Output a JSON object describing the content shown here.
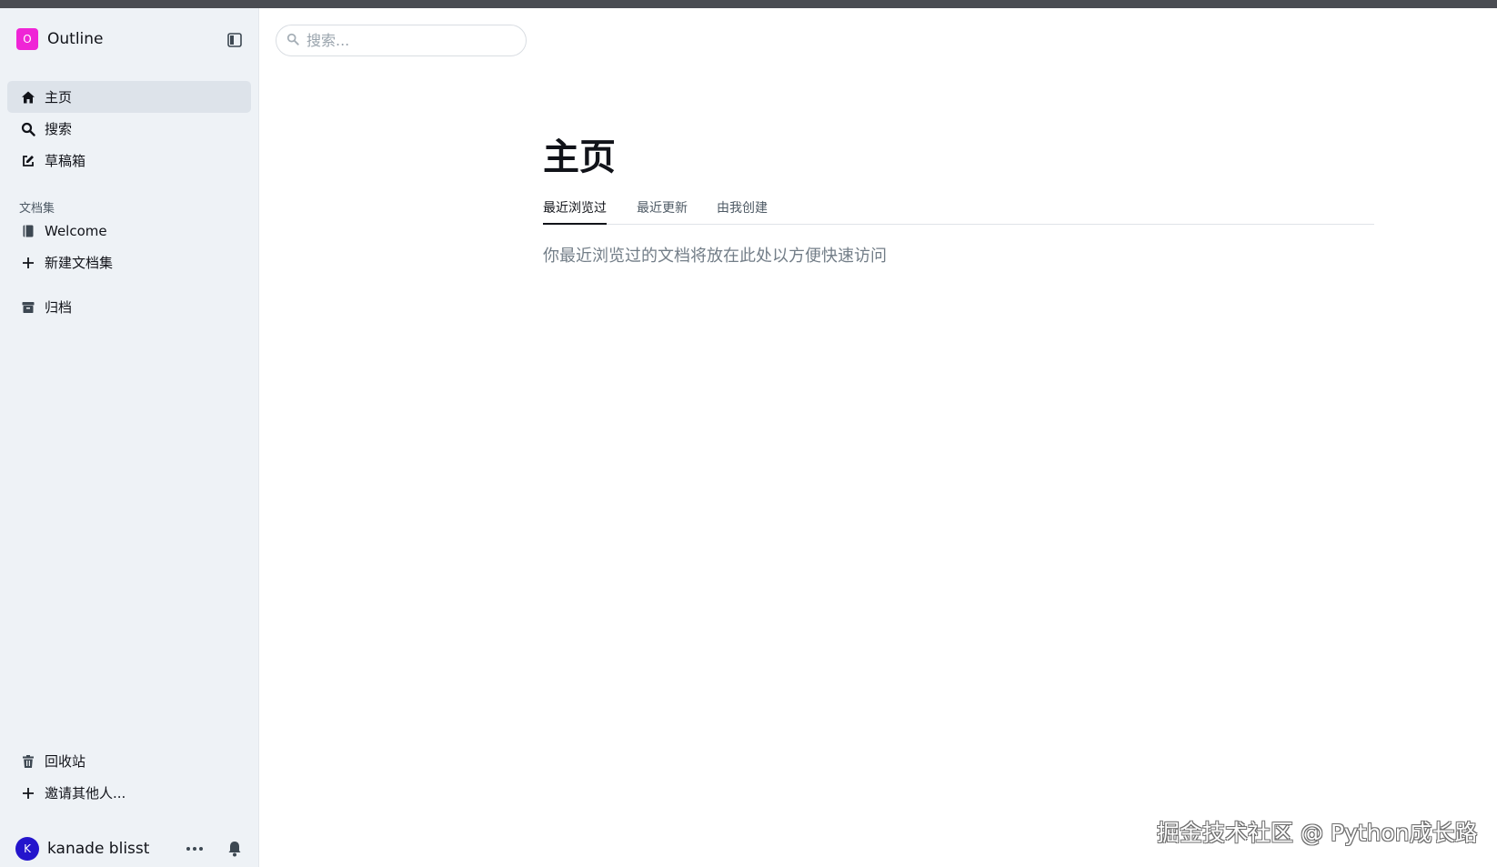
{
  "brand": {
    "logo_letter": "O",
    "name": "Outline",
    "logo_color": "#ef25d6"
  },
  "nav": {
    "home": "主页",
    "search": "搜索",
    "drafts": "草稿箱"
  },
  "collections": {
    "section_label": "文档集",
    "items": [
      "Welcome"
    ],
    "new_collection": "新建文档集"
  },
  "archive": "归档",
  "trash": "回收站",
  "invite": "邀请其他人...",
  "user": {
    "initial": "K",
    "name": "kanade blisst",
    "avatar_color": "#2415cc"
  },
  "search_box": {
    "placeholder": "搜索..."
  },
  "main": {
    "title": "主页",
    "tabs": [
      "最近浏览过",
      "最近更新",
      "由我创建"
    ],
    "active_tab": "最近浏览过",
    "empty_message": "你最近浏览过的文档将放在此处以方便快速访问"
  },
  "watermark": "掘金技术社区 @ Python成长路",
  "icons": [
    "home-icon",
    "search-icon",
    "edit-icon",
    "book-icon",
    "plus-icon",
    "archive-icon",
    "trash-icon",
    "more-icon",
    "bell-icon",
    "sidebar-toggle-icon"
  ]
}
